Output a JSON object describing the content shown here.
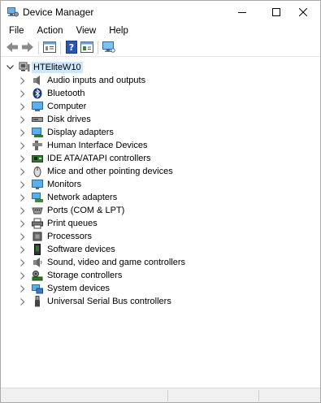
{
  "window": {
    "title": "Device Manager"
  },
  "menu": [
    "File",
    "Action",
    "View",
    "Help"
  ],
  "toolbar": [
    "back-icon",
    "forward-icon",
    "properties-icon",
    "help-icon",
    "update-driver-icon",
    "monitor-scan-icon"
  ],
  "tree": {
    "root": "HTEliteW10",
    "categories": [
      {
        "label": "Audio inputs and outputs",
        "icon": "speaker-icon"
      },
      {
        "label": "Bluetooth",
        "icon": "bluetooth-icon"
      },
      {
        "label": "Computer",
        "icon": "computer-icon"
      },
      {
        "label": "Disk drives",
        "icon": "disk-drive-icon"
      },
      {
        "label": "Display adapters",
        "icon": "display-adapter-icon"
      },
      {
        "label": "Human Interface Devices",
        "icon": "hid-icon"
      },
      {
        "label": "IDE ATA/ATAPI controllers",
        "icon": "ide-controller-icon"
      },
      {
        "label": "Mice and other pointing devices",
        "icon": "mouse-icon"
      },
      {
        "label": "Monitors",
        "icon": "monitor-icon"
      },
      {
        "label": "Network adapters",
        "icon": "network-adapter-icon"
      },
      {
        "label": "Ports (COM & LPT)",
        "icon": "port-icon"
      },
      {
        "label": "Print queues",
        "icon": "printer-icon"
      },
      {
        "label": "Processors",
        "icon": "processor-icon"
      },
      {
        "label": "Software devices",
        "icon": "software-device-icon"
      },
      {
        "label": "Sound, video and game controllers",
        "icon": "sound-icon"
      },
      {
        "label": "Storage controllers",
        "icon": "storage-controller-icon"
      },
      {
        "label": "System devices",
        "icon": "system-devices-icon"
      },
      {
        "label": "Universal Serial Bus controllers",
        "icon": "usb-icon"
      }
    ]
  },
  "colors": {
    "selection": "#cce8ff",
    "chevron": "#707070"
  }
}
